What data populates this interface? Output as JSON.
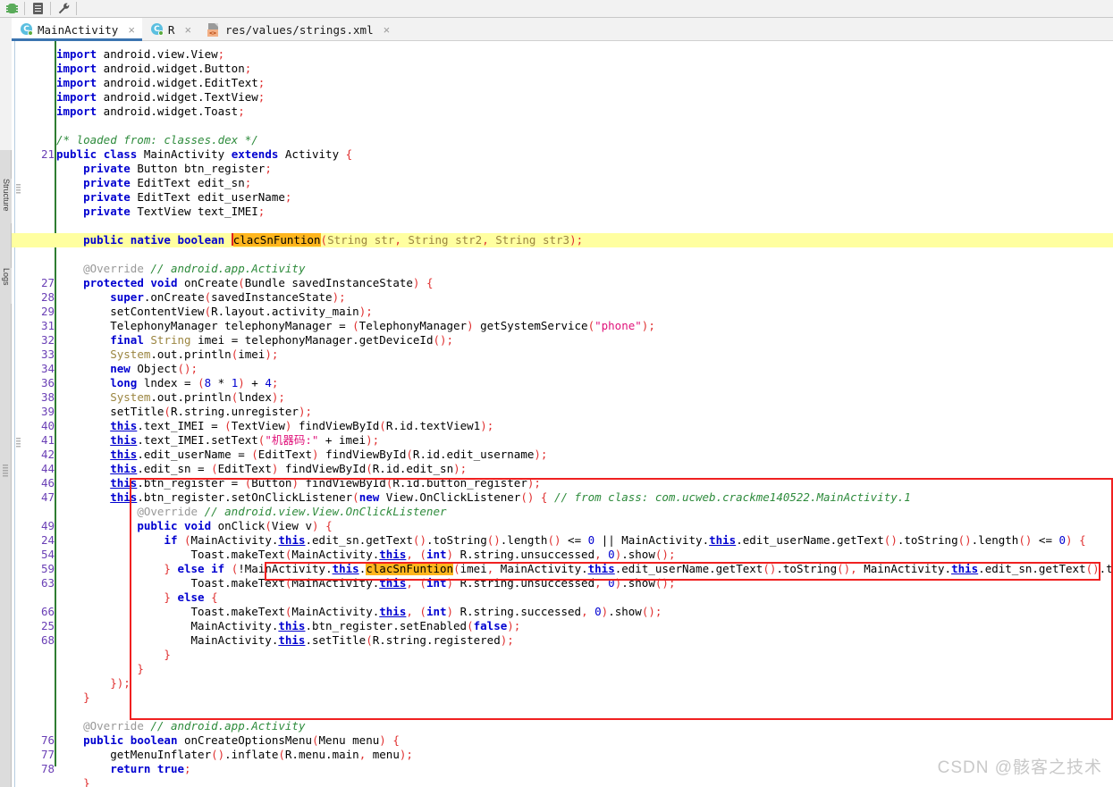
{
  "toolbar": {
    "icons": [
      {
        "name": "dex-bug-icon",
        "glyph": "bug"
      },
      {
        "name": "document-icon",
        "glyph": "doc"
      },
      {
        "name": "wrench-icon",
        "glyph": "wrench"
      }
    ]
  },
  "left_tool_strip": {
    "tabs": [
      "Structure",
      "Logs"
    ]
  },
  "tabs": [
    {
      "label": "MainActivity",
      "icon": "java-class-icon",
      "active": true,
      "close": "×"
    },
    {
      "label": "R",
      "icon": "java-class-icon",
      "active": false,
      "close": "×"
    },
    {
      "label": "res/values/strings.xml",
      "icon": "xml-file-icon",
      "active": false,
      "close": "×"
    }
  ],
  "editor": {
    "highlighted_line_index": 8,
    "highlight_color": "#ffffa0",
    "caret_symbol_color": "#e02020",
    "search_match_color": "#ffb61e",
    "change_bar_color": "#2f7d32",
    "line_number_color": "#6a3fb5",
    "annotation_box_color": "#f02020",
    "lines": [
      {
        "num": "",
        "text": "import android.view.View;"
      },
      {
        "num": "",
        "text": "import android.widget.Button;"
      },
      {
        "num": "",
        "text": "import android.widget.EditText;"
      },
      {
        "num": "",
        "text": "import android.widget.TextView;"
      },
      {
        "num": "",
        "text": "import android.widget.Toast;"
      },
      {
        "num": "",
        "text": ""
      },
      {
        "num": "",
        "text": "/* loaded from: classes.dex */"
      },
      {
        "num": "21",
        "text": "public class MainActivity extends Activity {"
      },
      {
        "num": "",
        "text": "    private Button btn_register;"
      },
      {
        "num": "",
        "text": "    private EditText edit_sn;"
      },
      {
        "num": "",
        "text": "    private EditText edit_userName;"
      },
      {
        "num": "",
        "text": "    private TextView text_IMEI;"
      },
      {
        "num": "",
        "text": ""
      },
      {
        "num": "",
        "text": "    public native boolean clacSnFuntion(String str, String str2, String str3);"
      },
      {
        "num": "",
        "text": ""
      },
      {
        "num": "",
        "text": "    @Override // android.app.Activity"
      },
      {
        "num": "27",
        "text": "    protected void onCreate(Bundle savedInstanceState) {"
      },
      {
        "num": "28",
        "text": "        super.onCreate(savedInstanceState);"
      },
      {
        "num": "29",
        "text": "        setContentView(R.layout.activity_main);"
      },
      {
        "num": "31",
        "text": "        TelephonyManager telephonyManager = (TelephonyManager) getSystemService(\"phone\");"
      },
      {
        "num": "32",
        "text": "        final String imei = telephonyManager.getDeviceId();"
      },
      {
        "num": "33",
        "text": "        System.out.println(imei);"
      },
      {
        "num": "34",
        "text": "        new Object();"
      },
      {
        "num": "36",
        "text": "        long lndex = (8 * 1) + 4;"
      },
      {
        "num": "38",
        "text": "        System.out.println(lndex);"
      },
      {
        "num": "39",
        "text": "        setTitle(R.string.unregister);"
      },
      {
        "num": "40",
        "text": "        this.text_IMEI = (TextView) findViewById(R.id.textView1);"
      },
      {
        "num": "41",
        "text": "        this.text_IMEI.setText(\"机器码:\" + imei);"
      },
      {
        "num": "42",
        "text": "        this.edit_userName = (EditText) findViewById(R.id.edit_username);"
      },
      {
        "num": "44",
        "text": "        this.edit_sn = (EditText) findViewById(R.id.edit_sn);"
      },
      {
        "num": "46",
        "text": "        this.btn_register = (Button) findViewById(R.id.button_register);"
      },
      {
        "num": "47",
        "text": "        this.btn_register.setOnClickListener(new View.OnClickListener() { // from class: com.ucweb.crackme140522.MainActivity.1"
      },
      {
        "num": "",
        "text": "            @Override // android.view.View.OnClickListener"
      },
      {
        "num": "49",
        "text": "            public void onClick(View v) {"
      },
      {
        "num": "24",
        "text": "                if (MainActivity.this.edit_sn.getText().toString().length() <= 0 || MainActivity.this.edit_userName.getText().toString().length() <= 0) {"
      },
      {
        "num": "54",
        "text": "                    Toast.makeText(MainActivity.this, (int) R.string.unsuccessed, 0).show();"
      },
      {
        "num": "59",
        "text": "                } else if (!MainActivity.this.clacSnFuntion(imei, MainActivity.this.edit_userName.getText().toString(), MainActivity.this.edit_sn.getText().toString()) {"
      },
      {
        "num": "63",
        "text": "                    Toast.makeText(MainActivity.this, (int) R.string.unsuccessed, 0).show();"
      },
      {
        "num": "",
        "text": "                } else {"
      },
      {
        "num": "66",
        "text": "                    Toast.makeText(MainActivity.this, (int) R.string.successed, 0).show();"
      },
      {
        "num": "25",
        "text": "                    MainActivity.this.btn_register.setEnabled(false);"
      },
      {
        "num": "68",
        "text": "                    MainActivity.this.setTitle(R.string.registered);"
      },
      {
        "num": "",
        "text": "                }"
      },
      {
        "num": "",
        "text": "            }"
      },
      {
        "num": "",
        "text": "        });"
      },
      {
        "num": "",
        "text": "    }"
      },
      {
        "num": "",
        "text": ""
      },
      {
        "num": "",
        "text": "    @Override // android.app.Activity"
      },
      {
        "num": "76",
        "text": "    public boolean onCreateOptionsMenu(Menu menu) {"
      },
      {
        "num": "77",
        "text": "        getMenuInflater().inflate(R.menu.main, menu);"
      },
      {
        "num": "78",
        "text": "        return true;"
      },
      {
        "num": "",
        "text": "    }"
      }
    ],
    "highlighted_symbol": "clacSnFuntion"
  },
  "watermark": {
    "text": "CSDN @骸客之技术"
  }
}
